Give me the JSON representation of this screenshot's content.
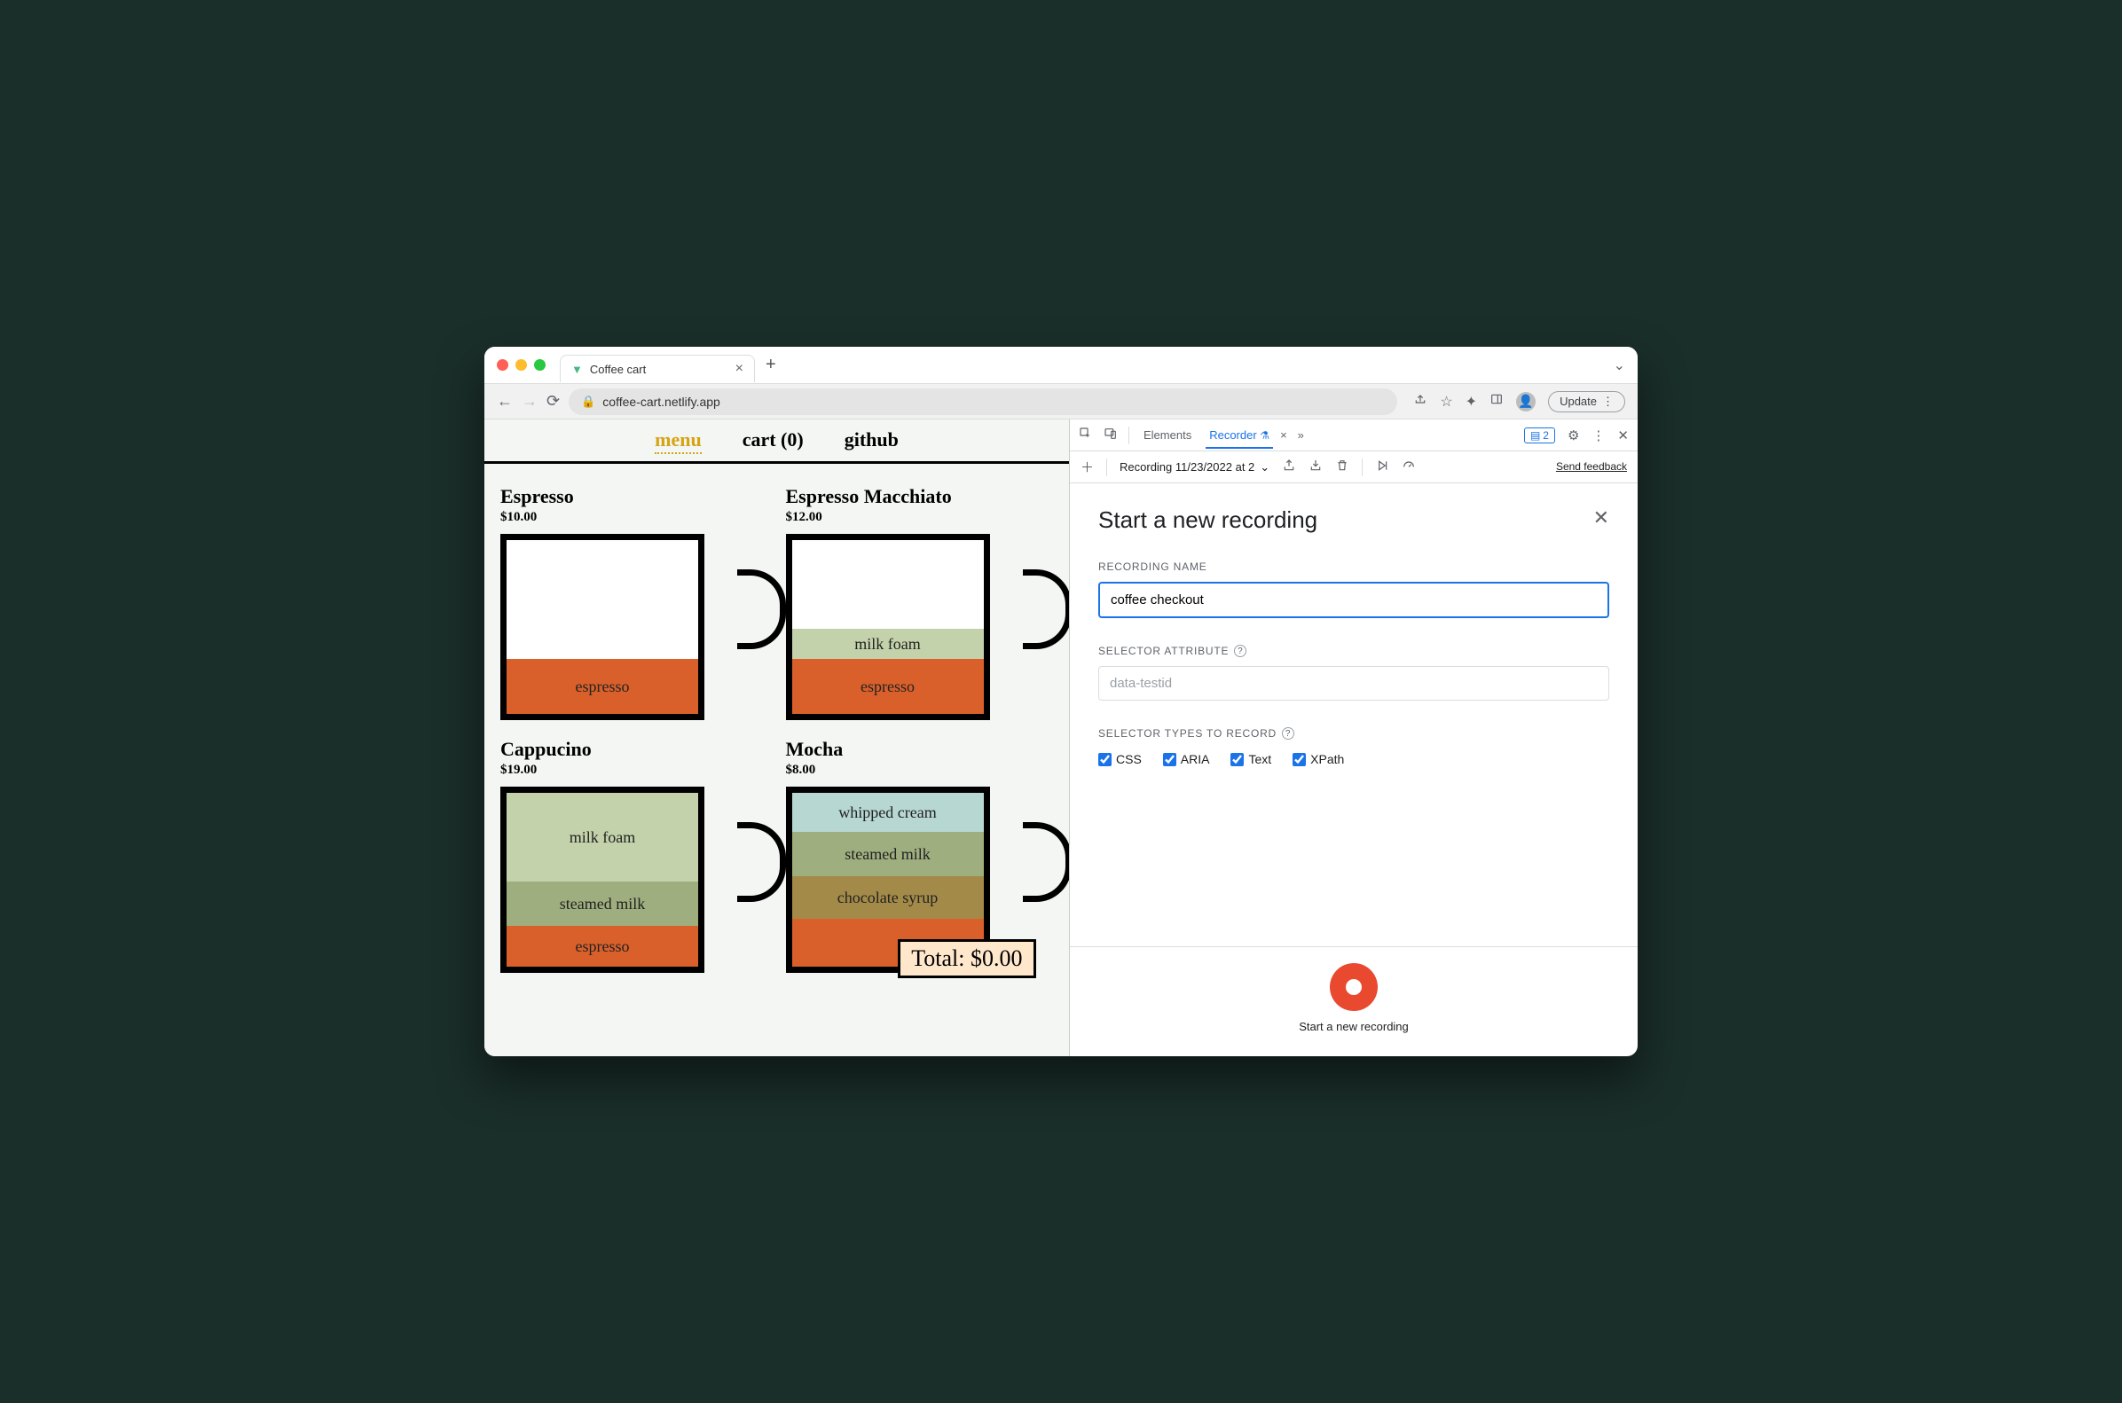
{
  "browser": {
    "tab_title": "Coffee cart",
    "url": "coffee-cart.netlify.app",
    "update_label": "Update"
  },
  "page": {
    "nav": {
      "menu": "menu",
      "cart": "cart (0)",
      "github": "github"
    },
    "products": [
      {
        "name": "Espresso",
        "price": "$10.00"
      },
      {
        "name": "Espresso Macchiato",
        "price": "$12.00"
      },
      {
        "name": "Cappucino",
        "price": "$19.00"
      },
      {
        "name": "Mocha",
        "price": "$8.00"
      }
    ],
    "layers": {
      "espresso": "espresso",
      "milk_foam": "milk foam",
      "steamed_milk": "steamed milk",
      "whipped_cream": "whipped cream",
      "chocolate_syrup": "chocolate syrup"
    },
    "total_label": "Total: $0.00"
  },
  "devtools": {
    "tabs": {
      "elements": "Elements",
      "recorder": "Recorder"
    },
    "issues_count": "2",
    "recording_dropdown": "Recording 11/23/2022 at 2",
    "feedback": "Send feedback",
    "panel": {
      "title": "Start a new recording",
      "name_label": "RECORDING NAME",
      "name_value": "coffee checkout",
      "attr_label": "SELECTOR ATTRIBUTE",
      "attr_placeholder": "data-testid",
      "types_label": "SELECTOR TYPES TO RECORD",
      "checks": {
        "css": "CSS",
        "aria": "ARIA",
        "text": "Text",
        "xpath": "XPath"
      },
      "start_label": "Start a new recording"
    }
  }
}
